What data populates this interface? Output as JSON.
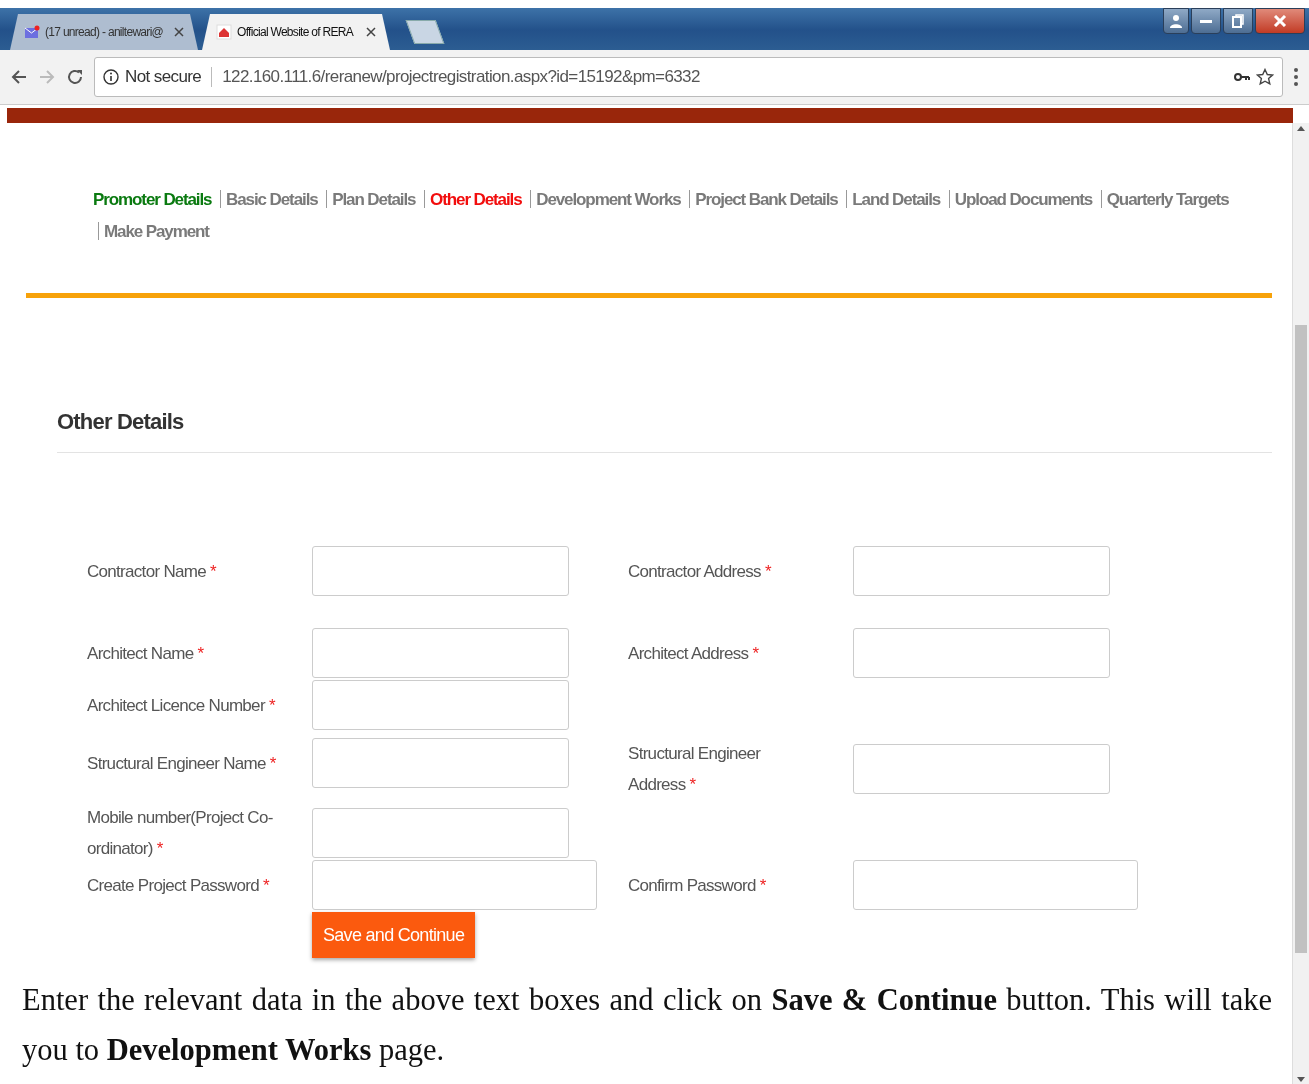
{
  "browser": {
    "tabs": [
      {
        "title": "(17 unread) - aniltewari@",
        "kind": "mail",
        "selected": false
      },
      {
        "title": "Official Website of RERA",
        "kind": "site",
        "selected": true
      }
    ],
    "security_label": "Not secure",
    "url": "122.160.111.6/reranew/projectregistration.aspx?id=15192&pm=6332"
  },
  "steps": [
    {
      "label": "Promoter Details",
      "kind": "completed"
    },
    {
      "label": "Basic Details",
      "kind": "pending"
    },
    {
      "label": "Plan Details",
      "kind": "pending"
    },
    {
      "label": "Other Details",
      "kind": "current"
    },
    {
      "label": "Development Works",
      "kind": "pending"
    },
    {
      "label": "Project Bank Details",
      "kind": "pending"
    },
    {
      "label": "Land Details",
      "kind": "pending"
    },
    {
      "label": "Upload Documents",
      "kind": "pending"
    },
    {
      "label": "Quarterly Targets",
      "kind": "pending"
    },
    {
      "label": "Make Payment",
      "kind": "pending"
    }
  ],
  "section_title": "Other Details",
  "form": {
    "rows": [
      {
        "left": {
          "label": "Contractor Name",
          "mark": "*",
          "kind": "text"
        },
        "right": {
          "label": "Contractor Address",
          "mark": "*",
          "kind": "text"
        }
      },
      {
        "left": {
          "label": "Architect Name",
          "mark": "*",
          "kind": "text"
        },
        "right": {
          "label": "Architect Address",
          "mark": "*",
          "kind": "text"
        }
      },
      {
        "left": {
          "label": "Architect Licence Number",
          "mark": "*",
          "kind": "text"
        }
      },
      {
        "left": {
          "label": "Structural Engineer Name",
          "mark": "*",
          "kind": "text"
        },
        "right": {
          "label": "Structural Engineer Address",
          "mark": "*",
          "kind": "text"
        }
      },
      {
        "left": {
          "label": "Mobile number(Project Co-ordinator)",
          "mark": "*",
          "kind": "text"
        }
      },
      {
        "left": {
          "label": "Create Project Password",
          "mark": "*",
          "kind": "password"
        },
        "right": {
          "label": "Confirm Password",
          "mark": "*",
          "kind": "password"
        }
      }
    ],
    "submit_button": "Save and Continue"
  },
  "caption": "Enter the relevant data in the above text boxes and click on **Save & Continue** button. This will take you to **Development Works** page."
}
